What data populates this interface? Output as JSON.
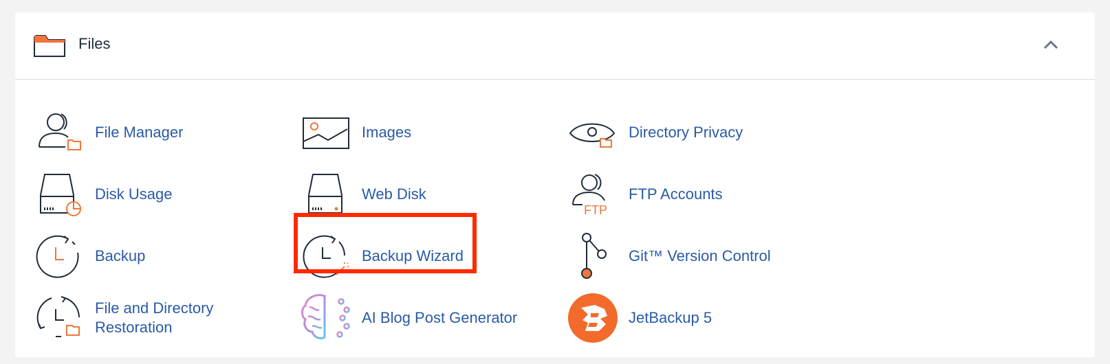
{
  "section": {
    "title": "Files",
    "icon": "folder-icon",
    "collapse_icon": "chevron-up-icon"
  },
  "items": [
    {
      "label": "File Manager",
      "icon": "file-manager-icon"
    },
    {
      "label": "Images",
      "icon": "image-icon"
    },
    {
      "label": "Directory Privacy",
      "icon": "eye-folder-icon"
    },
    {
      "label": "Disk Usage",
      "icon": "disk-usage-icon"
    },
    {
      "label": "Web Disk",
      "icon": "web-disk-icon"
    },
    {
      "label": "FTP Accounts",
      "icon": "ftp-user-icon"
    },
    {
      "label": "Backup",
      "icon": "clock-backup-icon"
    },
    {
      "label": "Backup Wizard",
      "icon": "backup-wizard-icon"
    },
    {
      "label": "Git™ Version Control",
      "icon": "git-branch-icon"
    },
    {
      "label": "File and Directory Restoration",
      "icon": "restore-icon"
    },
    {
      "label": "AI Blog Post Generator",
      "icon": "ai-brain-icon"
    },
    {
      "label": "JetBackup 5",
      "icon": "jetbackup-logo-icon"
    }
  ],
  "ftp_icon_text": "FTP",
  "colors": {
    "link": "#295aa6",
    "accent": "#f0763a",
    "highlight": "#ff2a00",
    "icon_stroke": "#1f2b3a"
  },
  "highlighted_item": "Backup Wizard"
}
